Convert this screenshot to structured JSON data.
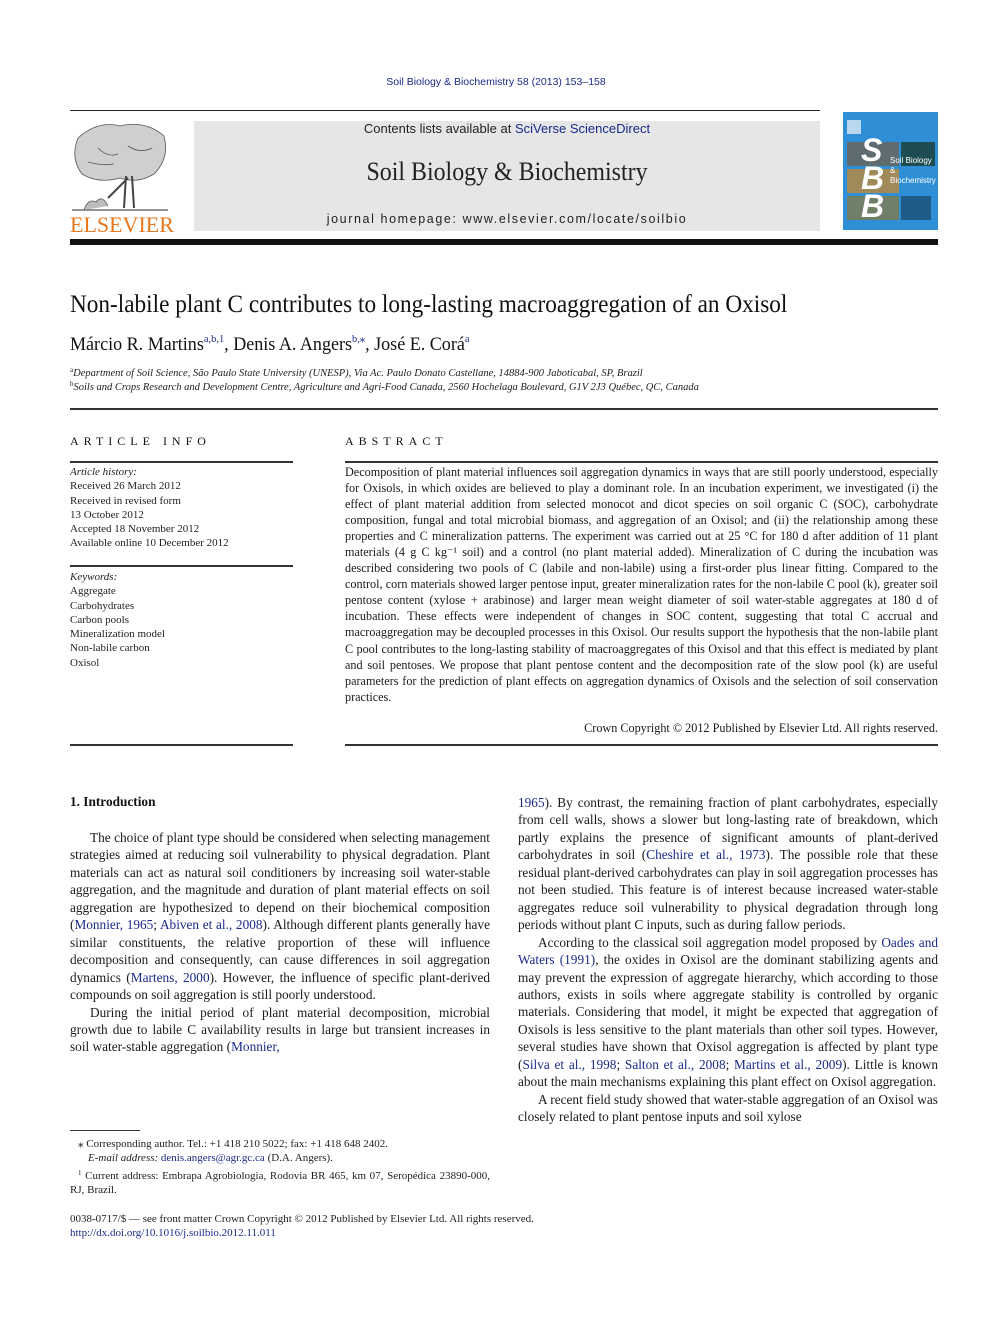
{
  "header": {
    "citation": "Soil Biology & Biochemistry 58 (2013) 153–158",
    "publisher_logo_text": "ELSEVIER",
    "contents_prefix": "Contents lists available at ",
    "contents_link": "SciVerse ScienceDirect",
    "journal_title": "Soil Biology & Biochemistry",
    "homepage": "journal homepage: www.elsevier.com/locate/soilbio",
    "cover": {
      "letters": [
        "S",
        "B",
        "B"
      ],
      "title_line1": "Soil Biology &",
      "title_line2": "Biochemistry",
      "background_color": "#2e8fd6"
    },
    "colors": {
      "elsevier_orange": "#e8781e",
      "link_blue": "#1a2a8a",
      "banner_gray": "#e6e6e6"
    }
  },
  "article": {
    "title": "Non-labile plant C contributes to long-lasting macroaggregation of an Oxisol",
    "authors": [
      {
        "name": "Márcio R. Martins",
        "sup": "a,b,1",
        "sep": ", "
      },
      {
        "name": "Denis A. Angers",
        "sup": "b,⁎",
        "sep": ", "
      },
      {
        "name": "José E. Corá",
        "sup": "a",
        "sep": ""
      }
    ],
    "affiliations": [
      {
        "mark": "a",
        "text": "Department of Soil Science, São Paulo State University (UNESP), Via Ac. Paulo Donato Castellane, 14884-900 Jaboticabal, SP, Brazil"
      },
      {
        "mark": "b",
        "text": "Soils and Crops Research and Development Centre, Agriculture and Agri-Food Canada, 2560 Hochelaga Boulevard, G1V 2J3 Québec, QC, Canada"
      }
    ]
  },
  "article_info": {
    "heading": "ARTICLE INFO",
    "history_label": "Article history:",
    "history": [
      "Received 26 March 2012",
      "Received in revised form",
      "13 October 2012",
      "Accepted 18 November 2012",
      "Available online 10 December 2012"
    ],
    "keywords_label": "Keywords:",
    "keywords": [
      "Aggregate",
      "Carbohydrates",
      "Carbon pools",
      "Mineralization model",
      "Non-labile carbon",
      "Oxisol"
    ]
  },
  "abstract": {
    "heading": "ABSTRACT",
    "text": "Decomposition of plant material influences soil aggregation dynamics in ways that are still poorly understood, especially for Oxisols, in which oxides are believed to play a dominant role. In an incubation experiment, we investigated (i) the effect of plant material addition from selected monocot and dicot species on soil organic C (SOC), carbohydrate composition, fungal and total microbial biomass, and aggregation of an Oxisol; and (ii) the relationship among these properties and C mineralization patterns. The experiment was carried out at 25 °C for 180 d after addition of 11 plant materials (4 g C kg⁻¹ soil) and a control (no plant material added). Mineralization of C during the incubation was described considering two pools of C (labile and non-labile) using a first-order plus linear fitting. Compared to the control, corn materials showed larger pentose input, greater mineralization rates for the non-labile C pool (k), greater soil pentose content (xylose + arabinose) and larger mean weight diameter of soil water-stable aggregates at 180 d of incubation. These effects were independent of changes in SOC content, suggesting that total C accrual and macroaggregation may be decoupled processes in this Oxisol. Our results support the hypothesis that the non-labile plant C pool contributes to the long-lasting stability of macroaggregates of this Oxisol and that this effect is mediated by plant and soil pentoses. We propose that plant pentose content and the decomposition rate of the slow pool (k) are useful parameters for the prediction of plant effects on aggregation dynamics of Oxisols and the selection of soil conservation practices.",
    "copyright": "Crown Copyright © 2012 Published by Elsevier Ltd. All rights reserved."
  },
  "introduction": {
    "heading": "1.  Introduction",
    "left_column": [
      {
        "indent": true,
        "parts": [
          {
            "t": "The choice of plant type should be considered when selecting management strategies aimed at reducing soil vulnerability to physical degradation. Plant materials can act as natural soil conditioners by increasing soil water-stable aggregation, and the magnitude and duration of plant material effects on soil aggregation are hypothesized to depend on their biochemical composition ("
          },
          {
            "link": "Monnier, 1965"
          },
          {
            "t": "; "
          },
          {
            "link": "Abiven et al., 2008"
          },
          {
            "t": "). Although different plants generally have similar constituents, the relative proportion of these will influence decomposition and consequently, can cause differences in soil aggregation dynamics ("
          },
          {
            "link": "Martens, 2000"
          },
          {
            "t": "). However, the influence of specific plant-derived compounds on soil aggregation is still poorly understood."
          }
        ]
      },
      {
        "indent": true,
        "parts": [
          {
            "t": "During the initial period of plant material decomposition, microbial growth due to labile C availability results in large but transient increases in soil water-stable aggregation ("
          },
          {
            "link": "Monnier,"
          }
        ]
      }
    ],
    "right_column": [
      {
        "indent": false,
        "parts": [
          {
            "link": "1965"
          },
          {
            "t": "). By contrast, the remaining fraction of plant carbohydrates, especially from cell walls, shows a slower but long-lasting rate of breakdown, which partly explains the presence of significant amounts of plant-derived carbohydrates in soil ("
          },
          {
            "link": "Cheshire et al., 1973"
          },
          {
            "t": "). The possible role that these residual plant-derived carbohydrates can play in soil aggregation processes has not been studied. This feature is of interest because increased water-stable aggregates reduce soil vulnerability to physical degradation through long periods without plant C inputs, such as during fallow periods."
          }
        ]
      },
      {
        "indent": true,
        "parts": [
          {
            "t": "According to the classical soil aggregation model proposed by "
          },
          {
            "link": "Oades and Waters (1991)"
          },
          {
            "t": ", the oxides in Oxisol are the dominant stabilizing agents and may prevent the expression of aggregate hierarchy, which according to those authors, exists in soils where aggregate stability is controlled by organic materials. Considering that model, it might be expected that aggregation of Oxisols is less sensitive to the plant materials than other soil types. However, several studies have shown that Oxisol aggregation is affected by plant type ("
          },
          {
            "link": "Silva et al., 1998"
          },
          {
            "t": "; "
          },
          {
            "link": "Salton et al., 2008"
          },
          {
            "t": "; "
          },
          {
            "link": "Martins et al., 2009"
          },
          {
            "t": "). Little is known about the main mechanisms explaining this plant effect on Oxisol aggregation."
          }
        ]
      },
      {
        "indent": true,
        "parts": [
          {
            "t": "A recent field study showed that water-stable aggregation of an Oxisol was closely related to plant pentose inputs and soil xylose"
          }
        ]
      }
    ]
  },
  "footnotes": {
    "corresponding": "⁎  Corresponding author. Tel.: +1 418 210 5022; fax: +1 418 648 2402.",
    "email_label": "E-mail address: ",
    "email": "denis.angers@agr.gc.ca",
    "email_suffix": " (D.A. Angers).",
    "current_address_mark": "1",
    "current_address": " Current address: Embrapa Agrobiologia, Rodovia BR 465, km 07, Seropédica 23890-000, RJ, Brazil."
  },
  "bottom": {
    "issn_line": "0038-0717/$ — see front matter Crown Copyright © 2012 Published by Elsevier Ltd. All rights reserved.",
    "doi": "http://dx.doi.org/10.1016/j.soilbio.2012.11.011"
  }
}
